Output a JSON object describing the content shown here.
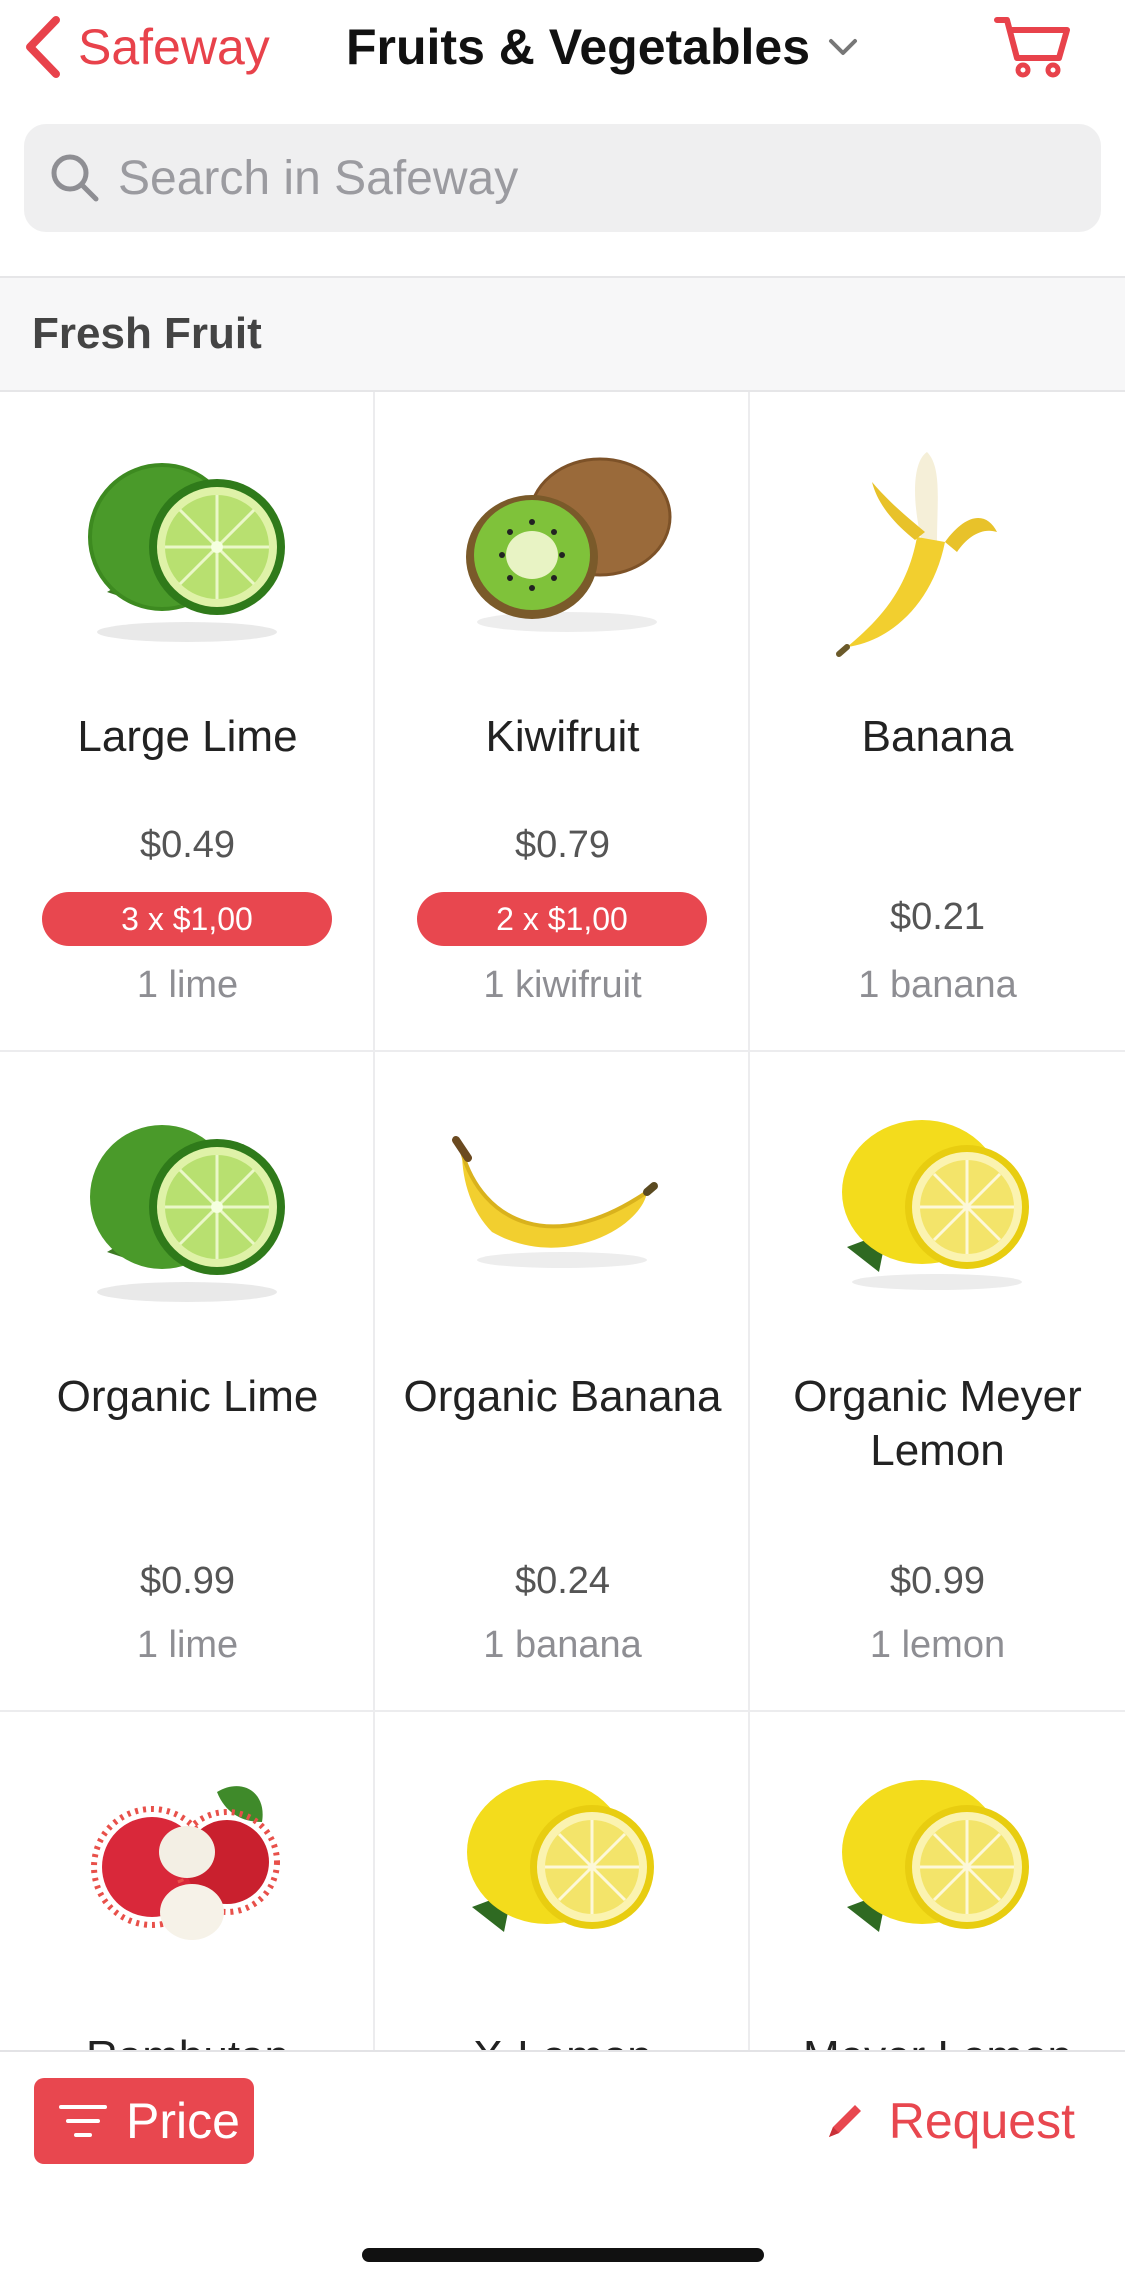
{
  "header": {
    "back_label": "Safeway",
    "title": "Fruits & Vegetables",
    "icons": {
      "back": "chevron-left-icon",
      "dropdown": "chevron-down-icon",
      "cart": "cart-icon"
    }
  },
  "search": {
    "placeholder": "Search in Safeway",
    "icon": "search-icon"
  },
  "section": {
    "title": "Fresh Fruit"
  },
  "products": [
    {
      "name": "Large Lime",
      "price": "$0.49",
      "deal": "3 x $1,00",
      "unit": "1 lime",
      "image": "lime"
    },
    {
      "name": "Kiwifruit",
      "price": "$0.79",
      "deal": "2 x $1,00",
      "unit": "1 kiwifruit",
      "image": "kiwi"
    },
    {
      "name": "Banana",
      "price": "$0.21",
      "deal": "",
      "unit": "1 banana",
      "image": "banana-peeled"
    },
    {
      "name": "Organic Lime",
      "price": "$0.99",
      "deal": "",
      "unit": "1 lime",
      "image": "lime"
    },
    {
      "name": "Organic Banana",
      "price": "$0.24",
      "deal": "",
      "unit": "1 banana",
      "image": "banana"
    },
    {
      "name": "Organic Meyer Lemon",
      "price": "$0.99",
      "deal": "",
      "unit": "1 lemon",
      "image": "lemon"
    },
    {
      "name": "Rambutan",
      "price": "",
      "deal": "",
      "unit": "",
      "image": "rambutan"
    },
    {
      "name": "X-Lemon",
      "price": "",
      "deal": "",
      "unit": "",
      "image": "lemon"
    },
    {
      "name": "Meyer Lemon",
      "price": "",
      "deal": "",
      "unit": "",
      "image": "lemon"
    }
  ],
  "bottom_bar": {
    "price_label": "Price",
    "request_label": "Request",
    "icons": {
      "filter": "filter-icon",
      "request": "pencil-icon"
    }
  },
  "colors": {
    "accent": "#e8474f",
    "deal_badge": "#e8474f",
    "search_bg": "#efeff0"
  }
}
